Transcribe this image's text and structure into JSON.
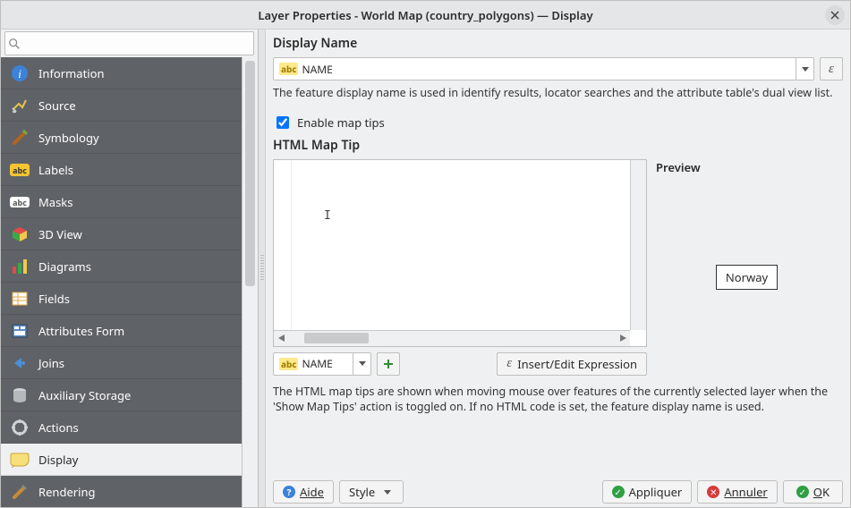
{
  "window": {
    "title": "Layer Properties - World Map (country_polygons) — Display"
  },
  "search": {
    "placeholder": ""
  },
  "sidebar": {
    "items": [
      {
        "label": "Information",
        "icon": "info"
      },
      {
        "label": "Source",
        "icon": "source"
      },
      {
        "label": "Symbology",
        "icon": "symbology"
      },
      {
        "label": "Labels",
        "icon": "labels"
      },
      {
        "label": "Masks",
        "icon": "masks"
      },
      {
        "label": "3D View",
        "icon": "3d"
      },
      {
        "label": "Diagrams",
        "icon": "diagrams"
      },
      {
        "label": "Fields",
        "icon": "fields"
      },
      {
        "label": "Attributes Form",
        "icon": "attrform"
      },
      {
        "label": "Joins",
        "icon": "joins"
      },
      {
        "label": "Auxiliary Storage",
        "icon": "aux"
      },
      {
        "label": "Actions",
        "icon": "actions"
      },
      {
        "label": "Display",
        "icon": "display",
        "active": true
      },
      {
        "label": "Rendering",
        "icon": "rendering"
      }
    ]
  },
  "display_name": {
    "section": "Display Name",
    "field_prefix": "abc",
    "field_value": "NAME",
    "description": "The feature display name is used in identify results, locator searches and the attribute table's dual view list."
  },
  "map_tips": {
    "enable_label": "Enable map tips",
    "enable_checked": true,
    "section": "HTML Map Tip",
    "preview_label": "Preview",
    "preview_value": "Norway",
    "field_prefix": "abc",
    "field_value": "NAME",
    "insert_label": "Insert/Edit Expression",
    "description": "The HTML map tips are shown when moving mouse over features of the currently selected layer when the 'Show Map Tips' action is toggled on. If no HTML code is set, the feature display name is used."
  },
  "footer": {
    "help": "Aide",
    "style": "Style",
    "apply": "Appliquer",
    "cancel": "Annuler",
    "ok": "OK"
  }
}
